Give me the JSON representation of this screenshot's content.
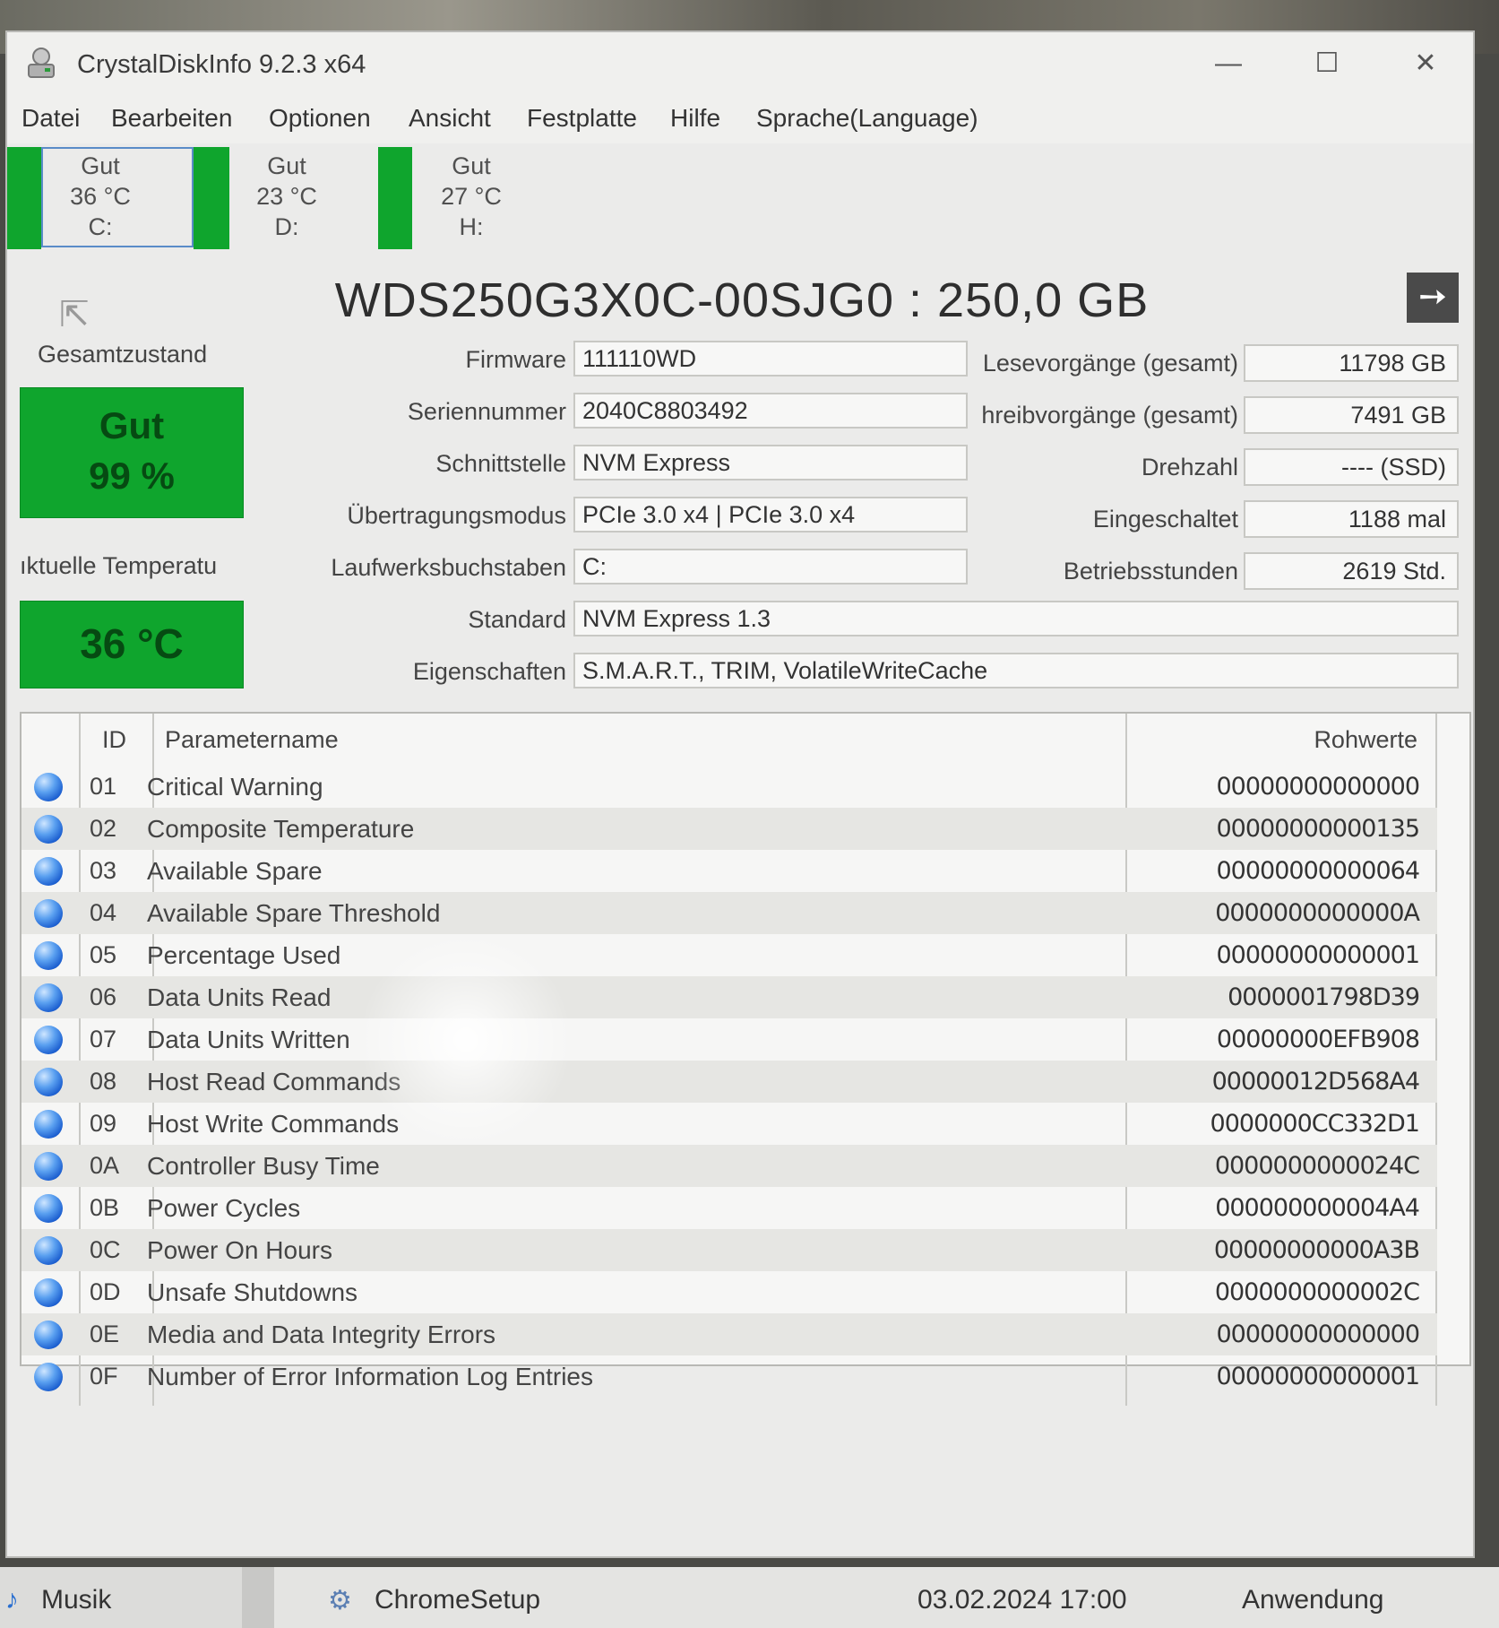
{
  "window": {
    "title": "CrystalDiskInfo 9.2.3 x64",
    "controls": {
      "minimize": "—",
      "maximize": "☐",
      "close": "✕"
    }
  },
  "menu": [
    "Datei",
    "Bearbeiten",
    "Optionen",
    "Ansicht",
    "Festplatte",
    "Hilfe",
    "Sprache(Language)"
  ],
  "drives": [
    {
      "status": "Gut",
      "temp": "36 °C",
      "letter": "C:",
      "selected": true
    },
    {
      "status": "Gut",
      "temp": "23 °C",
      "letter": "D:",
      "selected": false
    },
    {
      "status": "Gut",
      "temp": "27 °C",
      "letter": "H:",
      "selected": false
    }
  ],
  "disk": {
    "model": "WDS250G3X0C-00SJG0 : 250,0 GB",
    "next_button": "➙",
    "health_label": "Gesamtzustand",
    "health_status": "Gut",
    "health_percent": "99 %",
    "temp_label": "ıktuelle Temperatu",
    "temp_value": "36 °C",
    "fields": {
      "firmware_label": "Firmware",
      "firmware": "111110WD",
      "serial_label": "Seriennummer",
      "serial": "2040C8803492",
      "interface_label": "Schnittstelle",
      "interface": "NVM Express",
      "transfer_label": "Übertragungsmodus",
      "transfer": "PCIe 3.0 x4 | PCIe 3.0 x4",
      "letters_label": "Laufwerksbuchstaben",
      "letters": "C:",
      "standard_label": "Standard",
      "standard": "NVM Express 1.3",
      "features_label": "Eigenschaften",
      "features": "S.M.A.R.T., TRIM, VolatileWriteCache"
    },
    "stats": {
      "reads_label": "Lesevorgänge (gesamt)",
      "reads": "11798 GB",
      "writes_label": "hreibvorgänge (gesamt)",
      "writes": "7491 GB",
      "rpm_label": "Drehzahl",
      "rpm": "---- (SSD)",
      "power_on_count_label": "Eingeschaltet",
      "power_on_count": "1188 mal",
      "power_on_hours_label": "Betriebsstunden",
      "power_on_hours": "2619 Std."
    }
  },
  "smart": {
    "headers": {
      "id": "ID",
      "name": "Parametername",
      "raw": "Rohwerte"
    },
    "rows": [
      {
        "id": "01",
        "name": "Critical Warning",
        "raw": "00000000000000"
      },
      {
        "id": "02",
        "name": "Composite Temperature",
        "raw": "00000000000135"
      },
      {
        "id": "03",
        "name": "Available Spare",
        "raw": "00000000000064"
      },
      {
        "id": "04",
        "name": "Available Spare Threshold",
        "raw": "0000000000000A"
      },
      {
        "id": "05",
        "name": "Percentage Used",
        "raw": "00000000000001"
      },
      {
        "id": "06",
        "name": "Data Units Read",
        "raw": "0000001798D39"
      },
      {
        "id": "07",
        "name": "Data Units Written",
        "raw": "00000000EFB908"
      },
      {
        "id": "08",
        "name": "Host Read Commands",
        "raw": "00000012D568A4"
      },
      {
        "id": "09",
        "name": "Host Write Commands",
        "raw": "0000000CC332D1"
      },
      {
        "id": "0A",
        "name": "Controller Busy Time",
        "raw": "0000000000024C"
      },
      {
        "id": "0B",
        "name": "Power Cycles",
        "raw": "000000000004A4"
      },
      {
        "id": "0C",
        "name": "Power On Hours",
        "raw": "00000000000A3B"
      },
      {
        "id": "0D",
        "name": "Unsafe Shutdowns",
        "raw": "0000000000002C"
      },
      {
        "id": "0E",
        "name": "Media and Data Integrity Errors",
        "raw": "00000000000000"
      },
      {
        "id": "0F",
        "name": "Number of Error Information Log Entries",
        "raw": "00000000000001"
      }
    ]
  },
  "taskbar": {
    "item1": "Musik",
    "item2": "ChromeSetup",
    "date": "03.02.2024 17:00",
    "type": "Anwendung"
  },
  "colors": {
    "good_green": "#0fa52d",
    "status_dot": "#1c5fd0"
  }
}
